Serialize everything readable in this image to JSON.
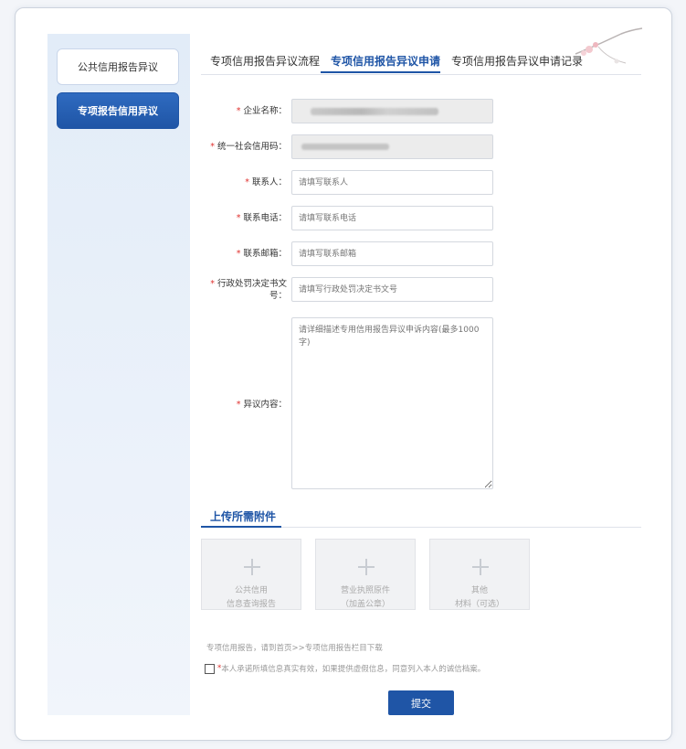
{
  "sidebar": {
    "items": [
      {
        "label": "公共信用报告异议"
      },
      {
        "label": "专项报告信用异议"
      }
    ]
  },
  "tabs": [
    {
      "label": "专项信用报告异议流程"
    },
    {
      "label": "专项信用报告异议申请"
    },
    {
      "label": "专项信用报告异议申请记录"
    }
  ],
  "form": {
    "company_name": {
      "label": "企业名称："
    },
    "credit_code": {
      "label": "统一社会信用码："
    },
    "contact": {
      "label": "联系人：",
      "placeholder": "请填写联系人"
    },
    "phone": {
      "label": "联系电话：",
      "placeholder": "请填写联系电话"
    },
    "email": {
      "label": "联系邮箱：",
      "placeholder": "请填写联系邮箱"
    },
    "decision_no": {
      "label_line1": "行政处罚决定书文",
      "label_line2": "号：",
      "placeholder": "请填写行政处罚决定书文号"
    },
    "objection": {
      "label": "异议内容：",
      "placeholder": "请详细描述专用信用报告异议申诉内容(最多1000字)"
    }
  },
  "attachments": {
    "title": "上传所需附件",
    "items": [
      {
        "line1": "公共信用",
        "line2": "信息查询报告"
      },
      {
        "line1": "营业执照原件",
        "line2": "（加盖公章）"
      },
      {
        "line1": "其他",
        "line2": "材料（可选）"
      }
    ]
  },
  "note": "专项信用报告，请到首页>>专项信用报告栏目下载",
  "agreement": "本人承诺所填信息真实有效，如果提供虚假信息，同意列入本人的诚信档案。",
  "required_mark": "*",
  "submit_label": "提交",
  "colors": {
    "accent": "#1f55a6",
    "required": "#e0322f"
  }
}
